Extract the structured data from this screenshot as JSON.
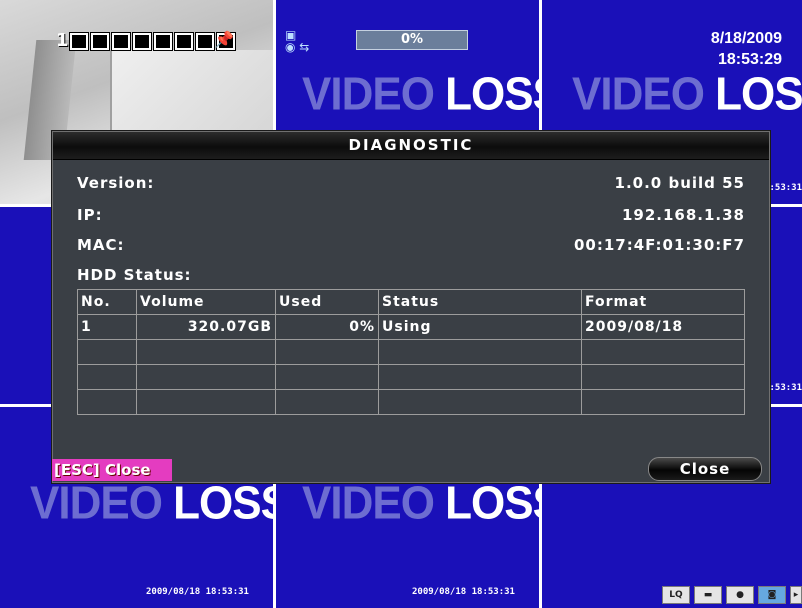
{
  "cameras": {
    "cam1": {
      "number": "1"
    },
    "cam2": {
      "progress": "0%"
    },
    "cam3": {
      "date": "8/18/2009",
      "time": "18:53:29"
    },
    "video_loss_v": "VIDEO",
    "video_loss_l": "LOSS",
    "timestamp": "2009/08/18 18:53:31",
    "timestamp_short": ":53:31"
  },
  "toolbar": {
    "lq": "LQ"
  },
  "dialog": {
    "title": "DIAGNOSTIC",
    "version_label": "Version:",
    "version_value": "1.0.0 build 55",
    "ip_label": "IP:",
    "ip_value": "192.168.1.38",
    "mac_label": "MAC:",
    "mac_value": "00:17:4F:01:30:F7",
    "hdd_label": "HDD Status:",
    "columns": [
      "No.",
      "Volume",
      "Used",
      "Status",
      "Format"
    ],
    "rows": [
      [
        "1",
        "320.07GB",
        "0%",
        "Using",
        "2009/08/18"
      ]
    ],
    "esc_hint": "[ESC] Close",
    "close_label": "Close"
  },
  "colors": {
    "background": "#1a10b8",
    "dialog": "#3a3f45",
    "esc": "#e43cc0"
  }
}
